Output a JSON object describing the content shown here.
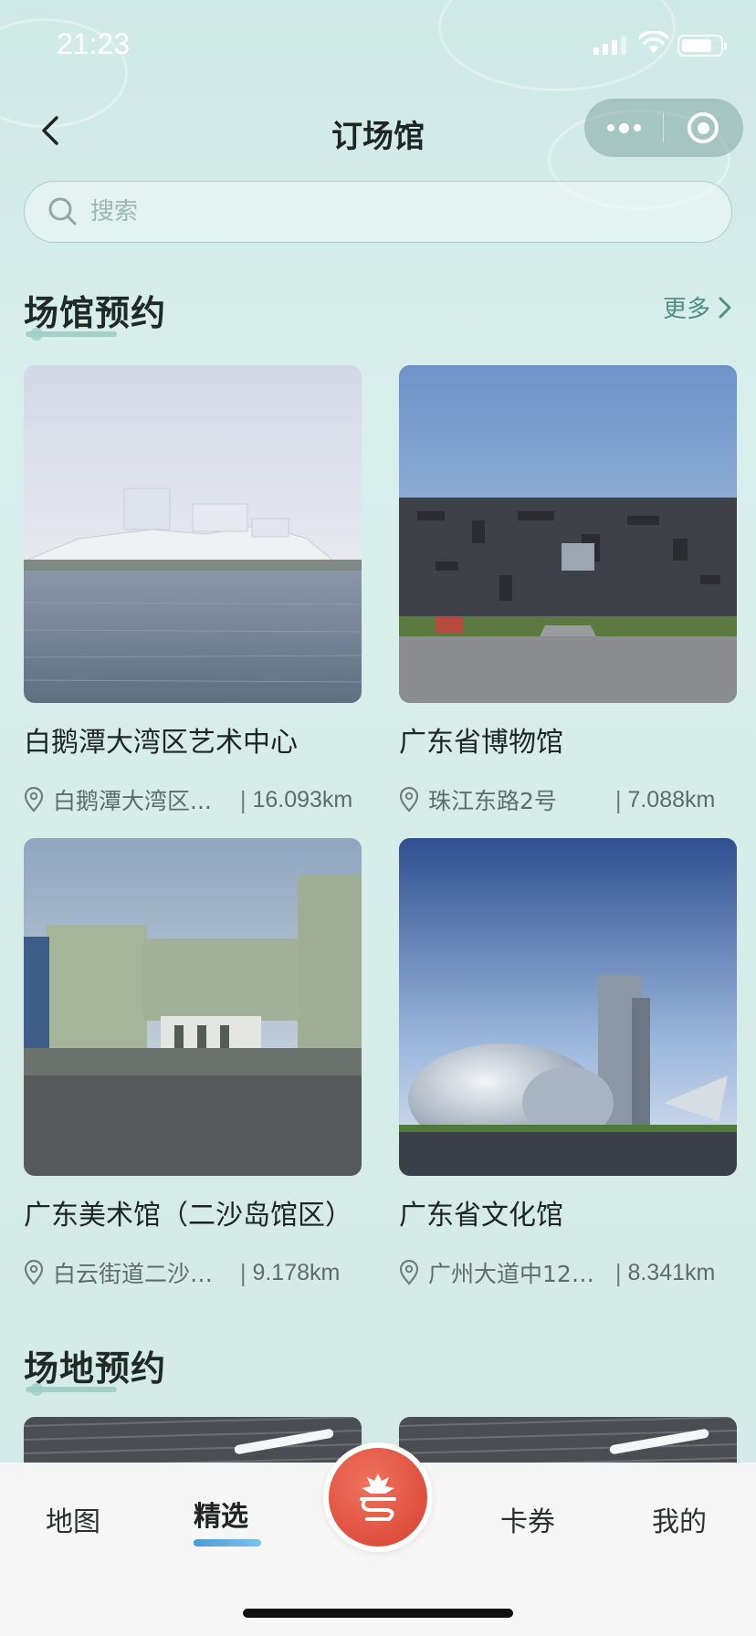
{
  "status_bar": {
    "time": "21:23"
  },
  "nav": {
    "title": "订场馆"
  },
  "search": {
    "placeholder": "搜索"
  },
  "venue_section": {
    "title": "场馆预约",
    "more_label": "更多"
  },
  "venues": [
    {
      "name": "白鹅潭大湾区艺术中心",
      "address": "白鹅潭大湾区...",
      "distance": "16.093km"
    },
    {
      "name": "广东省博物馆",
      "address": "珠江东路2号",
      "distance": "7.088km"
    },
    {
      "name": "广东美术馆（二沙岛馆区）",
      "address": "白云街道二沙岛...",
      "distance": "9.178km"
    },
    {
      "name": "广东省文化馆",
      "address": "广州大道中122...",
      "distance": "8.341km"
    }
  ],
  "site_section": {
    "title": "场地预约"
  },
  "tabbar": {
    "items": [
      {
        "label": "地图"
      },
      {
        "label": "精选"
      },
      {
        "label": "卡券"
      },
      {
        "label": "我的"
      }
    ]
  },
  "colors": {
    "accent": "#4f8f86",
    "tab_indicator": "#4a9ad6",
    "center_button": "#d8412f"
  }
}
